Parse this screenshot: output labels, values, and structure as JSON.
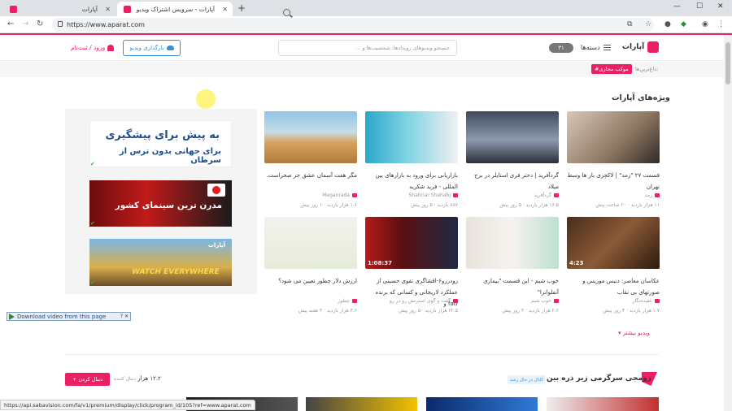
{
  "browser": {
    "tabs": [
      {
        "title": "آپارات"
      },
      {
        "title": "آپارات - سرویس اشتراک ویدیو"
      }
    ],
    "url": "https://www.aparat.com",
    "status_url": "https://api.sabavision.com/fa/v1/premium/display/click/program_id/105?ref=www.aparat.com"
  },
  "header": {
    "logo": "آپارات",
    "categories": "دسته‌ها",
    "toggle": "۳۱",
    "search_placeholder": "جستجو ویدیوهای رویدادها، شخصیت‌ها و ...",
    "upload": "بارگذاری ویدیو",
    "login": "ورود / ثبت‌نام"
  },
  "trending": {
    "label": "داغ‌ترین‌ها:",
    "tag": "#موکب مجازی"
  },
  "section": {
    "title": "ویژه‌های آپارات",
    "more": "ویدیو بیشتر"
  },
  "ads": {
    "ad1_line1": "به پیش برای پیشگیری",
    "ad1_line2": "برای جهانی بدون ترس از سرطان",
    "ad2_title": "مدرن ترین سینمای کشور",
    "ad3_brand": "آپارات",
    "ad3_text": "WATCH EVERYWHERE"
  },
  "videos": [
    {
      "title": "قسمت ۲۷ \"زمد\" | لاکچری باز ها وسط تهران",
      "channel": "زمد",
      "meta": "۱۱ هزار بازدید · ۲۰ ساعت پیش",
      "duration": ""
    },
    {
      "title": "گردآفرید | دختر فری استایلر در برج میلاد",
      "channel": "گردآفرید",
      "meta": "۱۶.۵ هزار بازدید · ۵ روز پیش",
      "duration": ""
    },
    {
      "title": "بازاریابی برای ورود به بازارهای بین المللی - فرید شکریه",
      "channel": "Shahriar Shahabi",
      "meta": "۸۸۷ بازدید · ۵ روز پیش",
      "duration": ""
    },
    {
      "title": "مگر هفت آسمان عشق جز صحراست.",
      "channel": "Meganrada",
      "meta": "۱.۸ هزار بازدید · ۱ روز پیش",
      "duration": ""
    },
    {
      "title": "عکاسان معاصر: دنیس موریس و صورتهای بی نقاب",
      "channel": "عقیده‌نگار",
      "meta": "۱.۷ هزار بازدید · ۴ روز پیش",
      "duration": "4:23"
    },
    {
      "title": "خوب شیم - این قسمت \"بیماری آنفلوانزا\"",
      "channel": "خوب شیم",
      "meta": "۲.۲ هزار بازدید · ۳ روز پیش",
      "duration": ""
    },
    {
      "title": "رودررو۶-اقشاگری تقوی حسینی از عملکرد لاریجانی و کسانی که برنده fatf و",
      "channel": "گفت و گوی استرنش رو در رو",
      "meta": "۶۲.۵ هزار بازدید · ۵ روز پیش",
      "duration": "1:08:37"
    },
    {
      "title": "ارزش دلار چطور تعیین می شود؟",
      "channel": "چطور",
      "meta": "۳.۶ هزار بازدید · ۳ هفته پیش",
      "duration": ""
    }
  ],
  "channel_row": {
    "title": "زومجی سرگرمی زیر ذره بین",
    "badge": "کانال در حال رشد",
    "followers": "۱۲.۲ هزار",
    "followers_label": "دنبال کننده",
    "follow": "+ دنبال کردن"
  },
  "download_bar": "Download video from this page",
  "colors": {
    "brand": "#ec1f66",
    "accent": "#3a8fd8"
  }
}
